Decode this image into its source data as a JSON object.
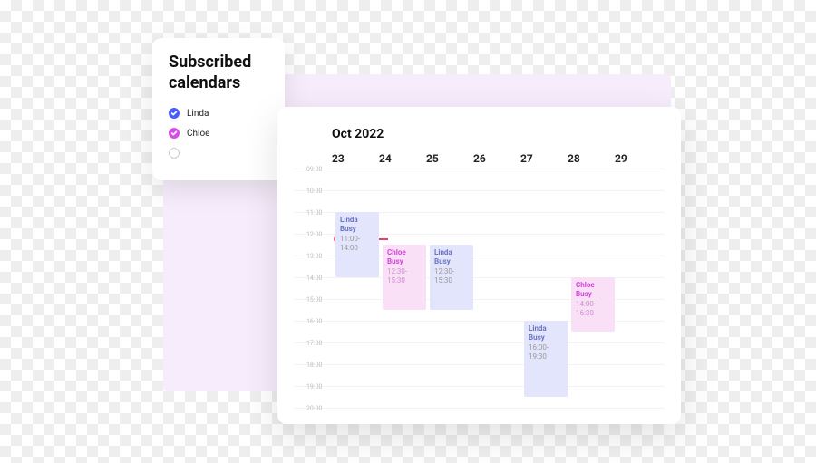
{
  "sidebar": {
    "title": "Subscribed calendars",
    "items": [
      {
        "label": "Linda",
        "color": "blue",
        "checked": true
      },
      {
        "label": "Chloe",
        "color": "pink",
        "checked": true
      },
      {
        "label": "",
        "color": "empty",
        "checked": false
      }
    ]
  },
  "calendar": {
    "title": "Oct 2022",
    "days": [
      "23",
      "24",
      "25",
      "26",
      "27",
      "28",
      "29"
    ],
    "hours": [
      "09:00",
      "10:00",
      "11:00",
      "12:00",
      "13:00",
      "14:00",
      "15:00",
      "16:00",
      "17:00",
      "18:00",
      "19:00",
      "20:00"
    ],
    "now_hour": 12.2,
    "now_day": 0,
    "events": [
      {
        "owner": "Linda",
        "status": "Busy",
        "time": "11:00-14:00",
        "day": 0,
        "start": 11,
        "end": 14,
        "cls": "linda"
      },
      {
        "owner": "Chloe",
        "status": "Busy",
        "time": "12:30-15:30",
        "day": 1,
        "start": 12.5,
        "end": 15.5,
        "cls": "chloe"
      },
      {
        "owner": "Linda",
        "status": "Busy",
        "time": "12:30-15:30",
        "day": 2,
        "start": 12.5,
        "end": 15.5,
        "cls": "linda"
      },
      {
        "owner": "Linda",
        "status": "Busy",
        "time": "16:00-19:30",
        "day": 4,
        "start": 16,
        "end": 19.5,
        "cls": "linda"
      },
      {
        "owner": "Chloe",
        "status": "Busy",
        "time": "14:00-16:30",
        "day": 5,
        "start": 14,
        "end": 16.5,
        "cls": "chloe"
      }
    ]
  }
}
